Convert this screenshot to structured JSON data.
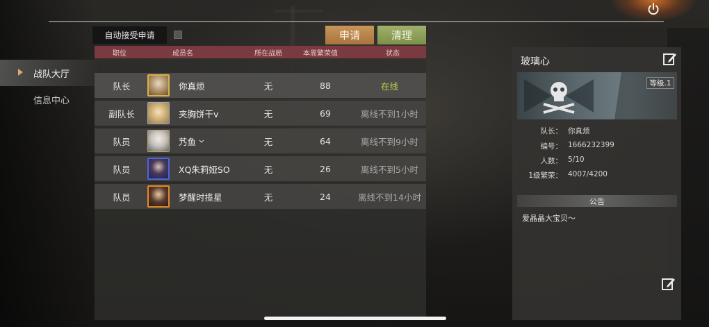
{
  "nav": {
    "items": [
      {
        "label": "战队大厅",
        "active": true
      },
      {
        "label": "信息中心",
        "active": false
      }
    ]
  },
  "controls": {
    "auto_accept_label": "自动接受申请",
    "auto_accept_checked": false,
    "apply_label": "申请",
    "clean_label": "清理"
  },
  "table": {
    "headers": [
      "职位",
      "成员名",
      "所在战局",
      "本周繁荣值",
      "状态"
    ],
    "rows": [
      {
        "position": "队长",
        "name": "你真烦",
        "battle": "无",
        "prosperity": "88",
        "status": "在线",
        "online": true,
        "avatar": "avatar-gold-frame-icon"
      },
      {
        "position": "副队长",
        "name": "夹胸饼干v",
        "battle": "无",
        "prosperity": "69",
        "status": "离线不到1小时",
        "online": false,
        "avatar": "avatar-blonde-icon"
      },
      {
        "position": "队员",
        "name": "艿鱼",
        "battle": "无",
        "prosperity": "64",
        "status": "离线不到9小时",
        "online": false,
        "avatar": "avatar-white-hair-icon"
      },
      {
        "position": "队员",
        "name": "XQ朱莉娅SO",
        "battle": "无",
        "prosperity": "26",
        "status": "离线不到5小时",
        "online": false,
        "avatar": "avatar-blue-frame-icon"
      },
      {
        "position": "队员",
        "name": "梦醒时揽星",
        "battle": "无",
        "prosperity": "24",
        "status": "离线不到14小时",
        "online": false,
        "avatar": "avatar-orange-frame-icon"
      }
    ]
  },
  "team": {
    "name": "玻璃心",
    "level": "等级.1",
    "captain_label": "队长：",
    "captain": "你真烦",
    "id_label": "编号：",
    "id": "1666232399",
    "members_label": "人数：",
    "members": "5/10",
    "prosperity_label": "1级繁荣：",
    "prosperity": "4007/4200",
    "notice_header": "公告",
    "notice": "爱晶晶大宝贝～"
  },
  "colors": {
    "apply_button": "#b8844a",
    "clean_button": "#8ea157",
    "table_header": "#7b3a40",
    "online_status": "#b9d24a",
    "nav_arrow": "#e0a86a"
  },
  "icons": {
    "power": "power-icon",
    "edit": "edit-icon",
    "team_emblem": "skull-emblem-icon"
  }
}
